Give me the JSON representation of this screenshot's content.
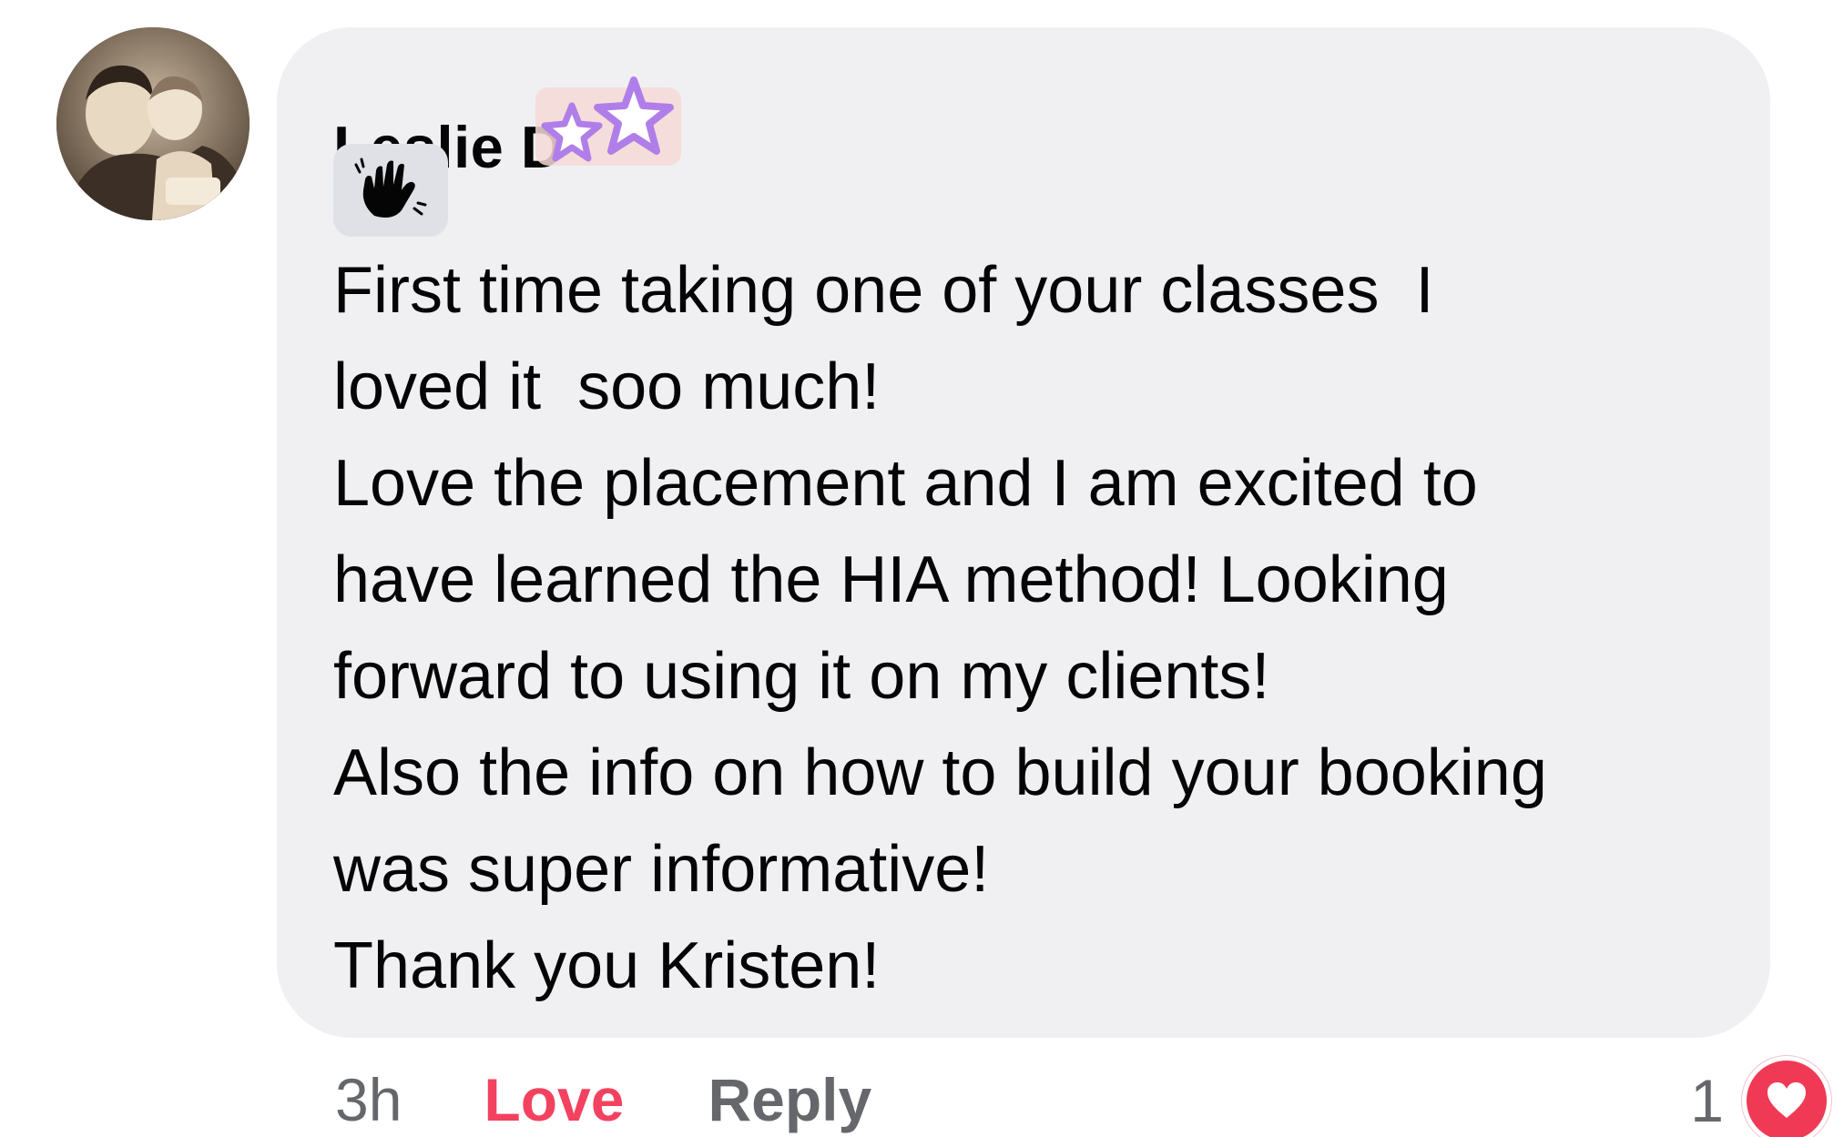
{
  "comment": {
    "author_name": "Leslie D",
    "sticker_icon": "stars-sticker-icon",
    "wave_icon": "waving-hand-icon",
    "text": "First time taking one of your classes  I\nloved it  soo much!\nLove the placement and I am excited to\nhave learned the HIA method! Looking\nforward to using it on my clients!\nAlso the info on how to build your booking\nwas super informative!\nThank you Kristen!"
  },
  "actions": {
    "timestamp": "3h",
    "love_label": "Love",
    "reply_label": "Reply"
  },
  "reactions": {
    "count": "1",
    "icon": "heart-icon"
  },
  "colors": {
    "bubble_bg": "#f0f0f3",
    "love": "#f3425f",
    "muted": "#65676b",
    "heart": "#f03a55"
  }
}
